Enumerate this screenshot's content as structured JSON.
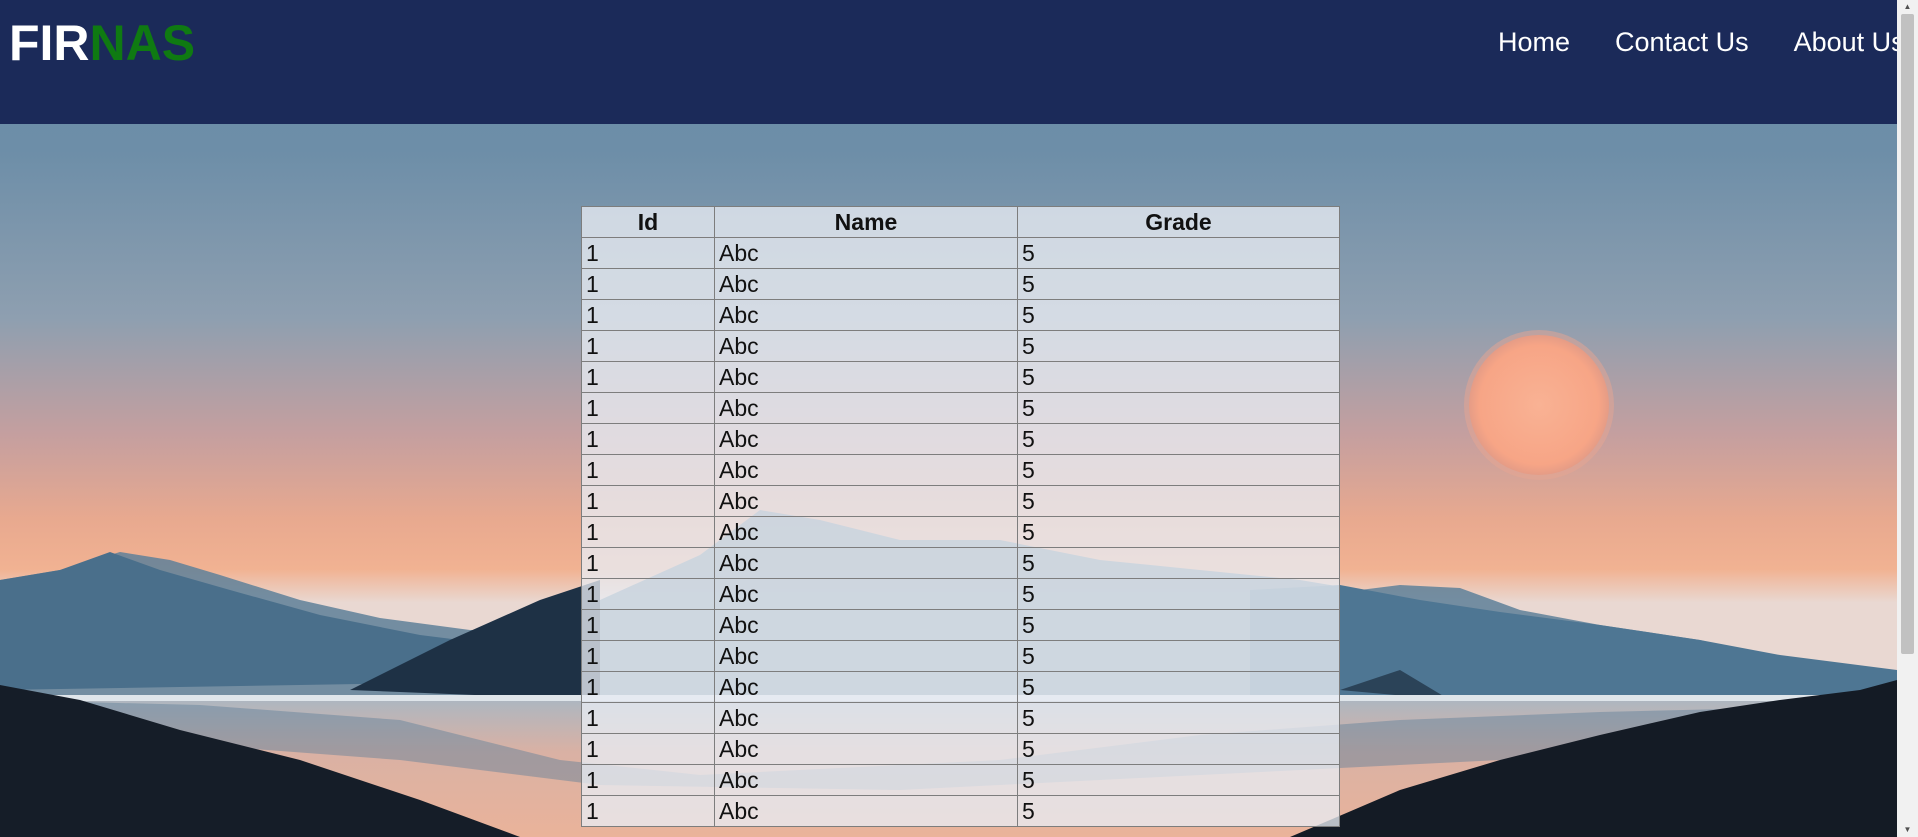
{
  "logo": {
    "part_a": "FIR",
    "part_b": "NAS"
  },
  "nav": {
    "items": [
      {
        "label": "Home"
      },
      {
        "label": "Contact Us"
      },
      {
        "label": "About Us"
      }
    ]
  },
  "table": {
    "headers": [
      "Id",
      "Name",
      "Grade"
    ],
    "rows": [
      [
        "1",
        "Abc",
        "5"
      ],
      [
        "1",
        "Abc",
        "5"
      ],
      [
        "1",
        "Abc",
        "5"
      ],
      [
        "1",
        "Abc",
        "5"
      ],
      [
        "1",
        "Abc",
        "5"
      ],
      [
        "1",
        "Abc",
        "5"
      ],
      [
        "1",
        "Abc",
        "5"
      ],
      [
        "1",
        "Abc",
        "5"
      ],
      [
        "1",
        "Abc",
        "5"
      ],
      [
        "1",
        "Abc",
        "5"
      ],
      [
        "1",
        "Abc",
        "5"
      ],
      [
        "1",
        "Abc",
        "5"
      ],
      [
        "1",
        "Abc",
        "5"
      ],
      [
        "1",
        "Abc",
        "5"
      ],
      [
        "1",
        "Abc",
        "5"
      ],
      [
        "1",
        "Abc",
        "5"
      ],
      [
        "1",
        "Abc",
        "5"
      ],
      [
        "1",
        "Abc",
        "5"
      ],
      [
        "1",
        "Abc",
        "5"
      ]
    ]
  },
  "colors": {
    "header_bg": "#1b2a59",
    "logo_accent": "#0f7a12",
    "sun": "#f9a98a"
  },
  "icons": {
    "scroll_up": "scroll-up-arrow-icon",
    "scroll_down": "scroll-down-arrow-icon"
  }
}
